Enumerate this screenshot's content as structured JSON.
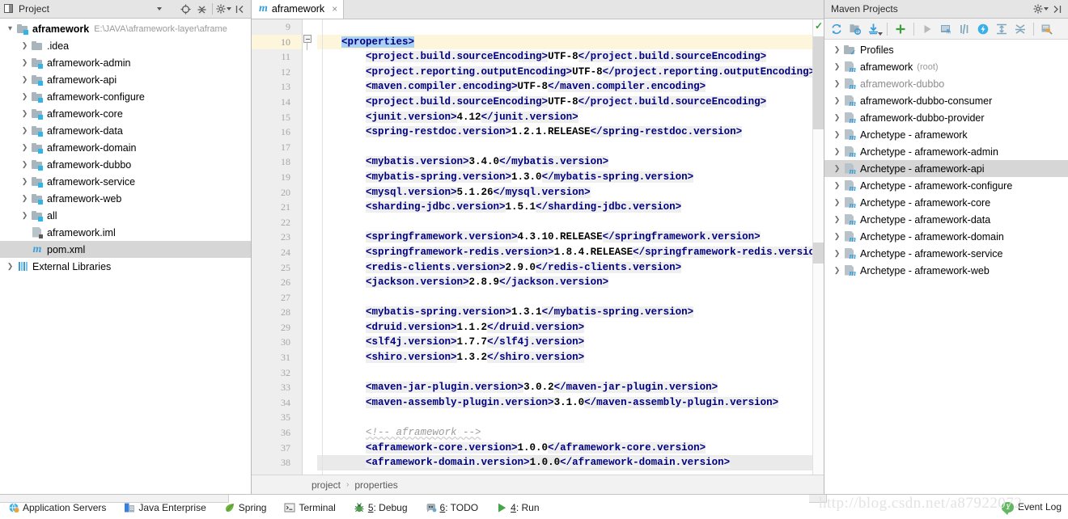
{
  "project_panel": {
    "title": "Project",
    "toolbar": [
      {
        "name": "locate-icon",
        "glyph": "⊕"
      },
      {
        "name": "collapse-all-icon",
        "glyph": "⩎"
      },
      {
        "name": "settings-gear-icon",
        "glyph": "⚙"
      },
      {
        "name": "hide-panel-icon",
        "glyph": "⇤"
      }
    ],
    "tree": [
      {
        "label": "aframework",
        "path": "E:\\JAVA\\aframework-layer\\aframe",
        "icon": "module-folder-icon",
        "arrow": "open",
        "indent": 0,
        "selected": false,
        "dim": false
      },
      {
        "label": ".idea",
        "path": "",
        "icon": "folder-icon",
        "arrow": "closed",
        "indent": 1,
        "selected": false,
        "dim": false
      },
      {
        "label": "aframework-admin",
        "path": "",
        "icon": "module-folder-icon",
        "arrow": "closed",
        "indent": 1,
        "selected": false,
        "dim": false
      },
      {
        "label": "aframework-api",
        "path": "",
        "icon": "module-folder-icon",
        "arrow": "closed",
        "indent": 1,
        "selected": false,
        "dim": false
      },
      {
        "label": "aframework-configure",
        "path": "",
        "icon": "module-folder-icon",
        "arrow": "closed",
        "indent": 1,
        "selected": false,
        "dim": false
      },
      {
        "label": "aframework-core",
        "path": "",
        "icon": "module-folder-icon",
        "arrow": "closed",
        "indent": 1,
        "selected": false,
        "dim": false
      },
      {
        "label": "aframework-data",
        "path": "",
        "icon": "module-folder-icon",
        "arrow": "closed",
        "indent": 1,
        "selected": false,
        "dim": false
      },
      {
        "label": "aframework-domain",
        "path": "",
        "icon": "module-folder-icon",
        "arrow": "closed",
        "indent": 1,
        "selected": false,
        "dim": false
      },
      {
        "label": "aframework-dubbo",
        "path": "",
        "icon": "module-folder-icon",
        "arrow": "closed",
        "indent": 1,
        "selected": false,
        "dim": false
      },
      {
        "label": "aframework-service",
        "path": "",
        "icon": "module-folder-icon",
        "arrow": "closed",
        "indent": 1,
        "selected": false,
        "dim": false
      },
      {
        "label": "aframework-web",
        "path": "",
        "icon": "module-folder-icon",
        "arrow": "closed",
        "indent": 1,
        "selected": false,
        "dim": false
      },
      {
        "label": "all",
        "path": "",
        "icon": "module-folder-icon",
        "arrow": "closed",
        "indent": 1,
        "selected": false,
        "dim": false
      },
      {
        "label": "aframework.iml",
        "path": "",
        "icon": "iml-file-icon",
        "arrow": "none",
        "indent": 1,
        "selected": false,
        "dim": false
      },
      {
        "label": "pom.xml",
        "path": "",
        "icon": "maven-file-icon",
        "arrow": "none",
        "indent": 1,
        "selected": true,
        "dim": false
      },
      {
        "label": "External Libraries",
        "path": "",
        "icon": "library-icon",
        "arrow": "closed",
        "indent": 0,
        "selected": false,
        "dim": false
      }
    ]
  },
  "editor": {
    "tab": {
      "label": "aframework",
      "icon": "maven-file-icon",
      "close": "×"
    },
    "first_line": 9,
    "breadcrumb": [
      "project",
      "properties"
    ],
    "breadcrumb_sep": "›",
    "inspection_status_icon": "green-check-icon",
    "lines": [
      {
        "n": 9,
        "segs": []
      },
      {
        "n": 10,
        "current": true,
        "fold": true,
        "segs": [
          {
            "t": "    ",
            "c": "pl"
          },
          {
            "t": "<properties>",
            "c": "tagsel"
          }
        ]
      },
      {
        "n": 11,
        "segs": [
          {
            "t": "        ",
            "c": "pl"
          },
          {
            "t": "<project.build.sourceEncoding>",
            "c": "tag"
          },
          {
            "t": "UTF-8",
            "c": "val"
          },
          {
            "t": "</project.build.sourceEncoding>",
            "c": "tag"
          }
        ]
      },
      {
        "n": 12,
        "segs": [
          {
            "t": "        ",
            "c": "pl"
          },
          {
            "t": "<project.reporting.outputEncoding>",
            "c": "tag"
          },
          {
            "t": "UTF-8",
            "c": "val"
          },
          {
            "t": "</project.reporting.outputEncoding>",
            "c": "tag"
          }
        ]
      },
      {
        "n": 13,
        "segs": [
          {
            "t": "        ",
            "c": "pl"
          },
          {
            "t": "<maven.compiler.encoding>",
            "c": "tag"
          },
          {
            "t": "UTF-8",
            "c": "val"
          },
          {
            "t": "</maven.compiler.encoding>",
            "c": "tag"
          }
        ]
      },
      {
        "n": 14,
        "segs": [
          {
            "t": "        ",
            "c": "pl"
          },
          {
            "t": "<project.build.sourceEncoding>",
            "c": "tag"
          },
          {
            "t": "UTF-8",
            "c": "val"
          },
          {
            "t": "</project.build.sourceEncoding>",
            "c": "tag"
          }
        ]
      },
      {
        "n": 15,
        "segs": [
          {
            "t": "        ",
            "c": "pl"
          },
          {
            "t": "<junit.version>",
            "c": "tag"
          },
          {
            "t": "4.12",
            "c": "val"
          },
          {
            "t": "</junit.version>",
            "c": "tag"
          }
        ]
      },
      {
        "n": 16,
        "segs": [
          {
            "t": "        ",
            "c": "pl"
          },
          {
            "t": "<spring-restdoc.version>",
            "c": "tag"
          },
          {
            "t": "1.2.1.RELEASE",
            "c": "val"
          },
          {
            "t": "</spring-restdoc.version>",
            "c": "tag"
          }
        ]
      },
      {
        "n": 17,
        "segs": []
      },
      {
        "n": 18,
        "segs": [
          {
            "t": "        ",
            "c": "pl"
          },
          {
            "t": "<mybatis.version>",
            "c": "tag"
          },
          {
            "t": "3.4.0",
            "c": "val"
          },
          {
            "t": "</mybatis.version>",
            "c": "tag"
          }
        ]
      },
      {
        "n": 19,
        "segs": [
          {
            "t": "        ",
            "c": "pl"
          },
          {
            "t": "<mybatis-spring.version>",
            "c": "tag"
          },
          {
            "t": "1.3.0",
            "c": "val"
          },
          {
            "t": "</mybatis-spring.version>",
            "c": "tag"
          }
        ]
      },
      {
        "n": 20,
        "segs": [
          {
            "t": "        ",
            "c": "pl"
          },
          {
            "t": "<mysql.version>",
            "c": "tag"
          },
          {
            "t": "5.1.26",
            "c": "val"
          },
          {
            "t": "</mysql.version>",
            "c": "tag"
          }
        ]
      },
      {
        "n": 21,
        "segs": [
          {
            "t": "        ",
            "c": "pl"
          },
          {
            "t": "<sharding-jdbc.version>",
            "c": "tag"
          },
          {
            "t": "1.5.1",
            "c": "val"
          },
          {
            "t": "</sharding-jdbc.version>",
            "c": "tag"
          }
        ]
      },
      {
        "n": 22,
        "segs": []
      },
      {
        "n": 23,
        "segs": [
          {
            "t": "        ",
            "c": "pl"
          },
          {
            "t": "<springframework.version>",
            "c": "tag"
          },
          {
            "t": "4.3.10.RELEASE",
            "c": "val"
          },
          {
            "t": "</springframework.version>",
            "c": "tag"
          }
        ]
      },
      {
        "n": 24,
        "segs": [
          {
            "t": "        ",
            "c": "pl"
          },
          {
            "t": "<springframework-redis.version>",
            "c": "tag"
          },
          {
            "t": "1.8.4.RELEASE",
            "c": "val"
          },
          {
            "t": "</springframework-redis.version>",
            "c": "tag"
          }
        ]
      },
      {
        "n": 25,
        "segs": [
          {
            "t": "        ",
            "c": "pl"
          },
          {
            "t": "<redis-clients.version>",
            "c": "tag"
          },
          {
            "t": "2.9.0",
            "c": "val"
          },
          {
            "t": "</redis-clients.version>",
            "c": "tag"
          }
        ]
      },
      {
        "n": 26,
        "segs": [
          {
            "t": "        ",
            "c": "pl"
          },
          {
            "t": "<jackson.version>",
            "c": "tag"
          },
          {
            "t": "2.8.9",
            "c": "val"
          },
          {
            "t": "</jackson.version>",
            "c": "tag"
          }
        ]
      },
      {
        "n": 27,
        "segs": []
      },
      {
        "n": 28,
        "segs": [
          {
            "t": "        ",
            "c": "pl"
          },
          {
            "t": "<mybatis-spring.version>",
            "c": "tag"
          },
          {
            "t": "1.3.1",
            "c": "val"
          },
          {
            "t": "</mybatis-spring.version>",
            "c": "tag"
          }
        ]
      },
      {
        "n": 29,
        "segs": [
          {
            "t": "        ",
            "c": "pl"
          },
          {
            "t": "<druid.version>",
            "c": "tag"
          },
          {
            "t": "1.1.2",
            "c": "val"
          },
          {
            "t": "</druid.version>",
            "c": "tag"
          }
        ]
      },
      {
        "n": 30,
        "segs": [
          {
            "t": "        ",
            "c": "pl"
          },
          {
            "t": "<slf4j.version>",
            "c": "tag"
          },
          {
            "t": "1.7.7",
            "c": "val"
          },
          {
            "t": "</slf4j.version>",
            "c": "tag"
          }
        ]
      },
      {
        "n": 31,
        "segs": [
          {
            "t": "        ",
            "c": "pl"
          },
          {
            "t": "<shiro.version>",
            "c": "tag"
          },
          {
            "t": "1.3.2",
            "c": "val"
          },
          {
            "t": "</shiro.version>",
            "c": "tag"
          }
        ]
      },
      {
        "n": 32,
        "segs": []
      },
      {
        "n": 33,
        "segs": [
          {
            "t": "        ",
            "c": "pl"
          },
          {
            "t": "<maven-jar-plugin.version>",
            "c": "tag"
          },
          {
            "t": "3.0.2",
            "c": "val"
          },
          {
            "t": "</maven-jar-plugin.version>",
            "c": "tag"
          }
        ]
      },
      {
        "n": 34,
        "segs": [
          {
            "t": "        ",
            "c": "pl"
          },
          {
            "t": "<maven-assembly-plugin.version>",
            "c": "tag"
          },
          {
            "t": "3.1.0",
            "c": "val"
          },
          {
            "t": "</maven-assembly-plugin.version>",
            "c": "tag"
          }
        ]
      },
      {
        "n": 35,
        "segs": []
      },
      {
        "n": 36,
        "segs": [
          {
            "t": "        ",
            "c": "pl"
          },
          {
            "t": "<!-- aframework -->",
            "c": "comment"
          }
        ]
      },
      {
        "n": 37,
        "segs": [
          {
            "t": "        ",
            "c": "pl"
          },
          {
            "t": "<aframework-core.version>",
            "c": "tag"
          },
          {
            "t": "1.0.0",
            "c": "val"
          },
          {
            "t": "</aframework-core.version>",
            "c": "tag"
          }
        ]
      },
      {
        "n": 38,
        "rowhl": true,
        "segs": [
          {
            "t": "        ",
            "c": "pl"
          },
          {
            "t": "<aframework-domain.version>",
            "c": "tag"
          },
          {
            "t": "1.0.0",
            "c": "val"
          },
          {
            "t": "</aframework-domain.version>",
            "c": "tag"
          }
        ]
      }
    ]
  },
  "maven_panel": {
    "title": "Maven Projects",
    "header_buttons": [
      {
        "name": "settings-gear-icon",
        "glyph": "⚙"
      },
      {
        "name": "hide-panel-icon",
        "glyph": "⇥"
      }
    ],
    "toolbar": [
      {
        "name": "reimport-icon"
      },
      {
        "name": "generate-sources-icon"
      },
      {
        "name": "download-sources-icon"
      },
      {
        "name": "add-maven-project-icon"
      },
      {
        "name": "run-icon"
      },
      {
        "name": "execute-goal-icon"
      },
      {
        "name": "toggle-skip-tests-icon"
      },
      {
        "name": "toggle-offline-icon"
      },
      {
        "name": "expand-all-icon"
      },
      {
        "name": "collapse-all-icon"
      },
      {
        "name": "maven-settings-icon"
      }
    ],
    "tree": [
      {
        "label": "Profiles",
        "suffix": "",
        "icon": "profiles-folder-icon",
        "arrow": "closed",
        "selected": false,
        "dim": false
      },
      {
        "label": "aframework",
        "suffix": "(root)",
        "icon": "maven-module-icon",
        "arrow": "closed",
        "selected": false,
        "dim": false
      },
      {
        "label": "aframework-dubbo",
        "suffix": "",
        "icon": "maven-module-icon",
        "arrow": "closed",
        "selected": false,
        "dim": true
      },
      {
        "label": "aframework-dubbo-consumer",
        "suffix": "",
        "icon": "maven-module-icon",
        "arrow": "closed",
        "selected": false,
        "dim": false
      },
      {
        "label": "aframework-dubbo-provider",
        "suffix": "",
        "icon": "maven-module-icon",
        "arrow": "closed",
        "selected": false,
        "dim": false
      },
      {
        "label": "Archetype - aframework",
        "suffix": "",
        "icon": "maven-module-icon",
        "arrow": "closed",
        "selected": false,
        "dim": false
      },
      {
        "label": "Archetype - aframework-admin",
        "suffix": "",
        "icon": "maven-module-icon",
        "arrow": "closed",
        "selected": false,
        "dim": false
      },
      {
        "label": "Archetype - aframework-api",
        "suffix": "",
        "icon": "maven-module-icon",
        "arrow": "closed",
        "selected": true,
        "dim": false
      },
      {
        "label": "Archetype - aframework-configure",
        "suffix": "",
        "icon": "maven-module-icon",
        "arrow": "closed",
        "selected": false,
        "dim": false
      },
      {
        "label": "Archetype - aframework-core",
        "suffix": "",
        "icon": "maven-module-icon",
        "arrow": "closed",
        "selected": false,
        "dim": false
      },
      {
        "label": "Archetype - aframework-data",
        "suffix": "",
        "icon": "maven-module-icon",
        "arrow": "closed",
        "selected": false,
        "dim": false
      },
      {
        "label": "Archetype - aframework-domain",
        "suffix": "",
        "icon": "maven-module-icon",
        "arrow": "closed",
        "selected": false,
        "dim": false
      },
      {
        "label": "Archetype - aframework-service",
        "suffix": "",
        "icon": "maven-module-icon",
        "arrow": "closed",
        "selected": false,
        "dim": false
      },
      {
        "label": "Archetype - aframework-web",
        "suffix": "",
        "icon": "maven-module-icon",
        "arrow": "closed",
        "selected": false,
        "dim": false
      }
    ]
  },
  "statusbar": {
    "items": [
      {
        "label": "Application Servers",
        "icon": "application-servers-icon",
        "mnemonic": ""
      },
      {
        "label": "Java Enterprise",
        "icon": "java-enterprise-icon",
        "mnemonic": ""
      },
      {
        "label": "Spring",
        "icon": "spring-leaf-icon",
        "mnemonic": ""
      },
      {
        "label": "Terminal",
        "icon": "terminal-icon",
        "mnemonic": ""
      },
      {
        "label": ": Debug",
        "icon": "debug-bug-icon",
        "mnemonic": "5"
      },
      {
        "label": ": TODO",
        "icon": "todo-icon",
        "mnemonic": "6"
      },
      {
        "label": ": Run",
        "icon": "run-play-icon",
        "mnemonic": "4"
      }
    ],
    "event_log": {
      "label": "Event Log",
      "count": "1"
    }
  },
  "watermark": "http://blog.csdn.net/a87922072"
}
